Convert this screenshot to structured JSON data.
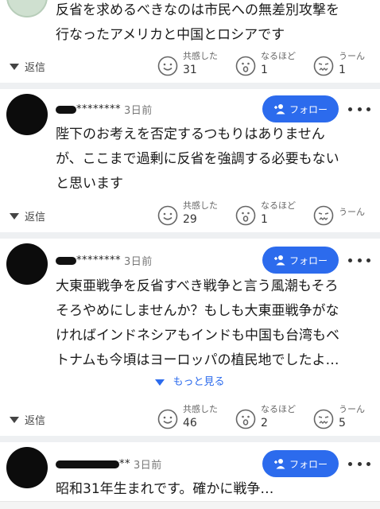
{
  "comments": [
    {
      "text": "反省を求めるべきなのは市民への無差別攻撃を\n行なったアメリカと中国とロシアです",
      "reply_label": "返信",
      "reactions": [
        {
          "label": "共感した",
          "count": "31",
          "icon": "smile-icon"
        },
        {
          "label": "なるほど",
          "count": "1",
          "icon": "surprised-icon"
        },
        {
          "label": "うーん",
          "count": "1",
          "icon": "confused-icon"
        }
      ]
    },
    {
      "user": "********",
      "time": "3日前",
      "follow_label": "フォロー",
      "text": "陛下のお考えを否定するつもりはありません\nが、ここまで過剰に反省を強調する必要もない\nと思います",
      "reply_label": "返信",
      "reactions": [
        {
          "label": "共感した",
          "count": "29",
          "icon": "smile-icon"
        },
        {
          "label": "なるほど",
          "count": "1",
          "icon": "surprised-icon"
        },
        {
          "label": "うーん",
          "count": "",
          "icon": "confused-icon"
        }
      ]
    },
    {
      "user": "********",
      "time": "3日前",
      "follow_label": "フォロー",
      "text": "大東亜戦争を反省すべき戦争と言う風潮もそろ\nそろやめにしませんか？もしも大東亜戦争がな\nければインドネシアもインドも中国も台湾もベ\nトナムも今頃はヨーロッパの植民地でしたよ…",
      "see_more": "もっと見る",
      "reply_label": "返信",
      "reactions": [
        {
          "label": "共感した",
          "count": "46",
          "icon": "smile-icon"
        },
        {
          "label": "なるほど",
          "count": "2",
          "icon": "surprised-icon"
        },
        {
          "label": "うーん",
          "count": "5",
          "icon": "confused-icon"
        }
      ]
    },
    {
      "user": "**",
      "time": "3日前",
      "follow_label": "フォロー",
      "text": "昭和31年生まれです。確かに戦争…"
    }
  ]
}
